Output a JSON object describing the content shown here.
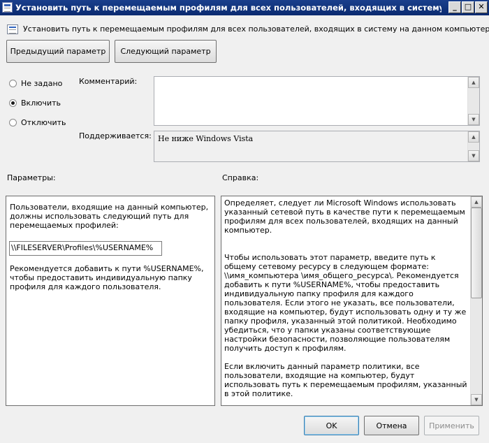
{
  "window": {
    "title": "Установить путь к перемещаемым профилям для всех пользователей, входящих в систему на данном ..."
  },
  "header": {
    "text": "Установить путь к перемещаемым профилям для всех пользователей, входящих в систему на данном компьютере"
  },
  "nav": {
    "prev_label": "Предыдущий параметр",
    "next_label": "Следующий параметр"
  },
  "state": {
    "not_configured": "Не задано",
    "enabled": "Включить",
    "disabled": "Отключить",
    "selected": "enabled"
  },
  "comment": {
    "label": "Комментарий:",
    "value": ""
  },
  "supported": {
    "label": "Поддерживается:",
    "value": "Не ниже Windows Vista"
  },
  "options": {
    "label": "Параметры:",
    "description": "Пользователи, входящие на данный компьютер, должны использовать следующий путь для перемещаемых профилей:",
    "path_value": "\\\\FILESERVER\\Profiles\\%USERNAME%",
    "note": "Рекомендуется добавить к пути %USERNAME%, чтобы предоставить индивидуальную папку профиля для каждого пользователя."
  },
  "help": {
    "label": "Справка:",
    "paragraphs": [
      "Определяет, следует ли Microsoft Windows использовать указанный сетевой путь в качестве пути к перемещаемым профилям для всех пользователей, входящих на данный компьютер.",
      "Чтобы использовать этот параметр, введите путь к общему сетевому ресурсу в следующем формате: \\\\имя_компьютера \\имя_общего_ресурса\\. Рекомендуется добавить к пути %USERNAME%, чтобы предоставить индивидуальную папку профиля для каждого пользователя. Если этого не указать, все пользователи, входящие на компьютер, будут использовать одну и ту же папку профиля, указанный этой политикой. Необходимо убедиться, что у папки указаны соответствующие настройки безопасности, позволяющие пользователям получить доступ к профилям.",
      "Если включить данный параметр политики, все пользователи, входящие на компьютер, будут использовать путь к перемещаемым профилям, указанный в этой политике."
    ]
  },
  "buttons": {
    "ok": "OK",
    "cancel": "Отмена",
    "apply": "Применить"
  }
}
